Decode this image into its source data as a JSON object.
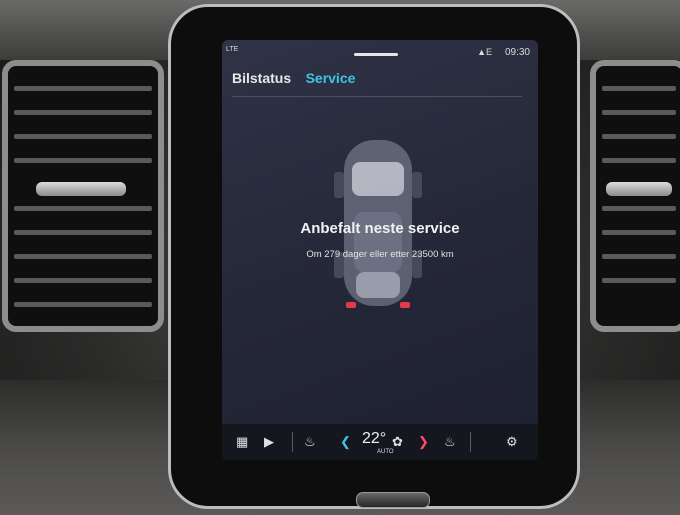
{
  "status_bar": {
    "network": "LTE",
    "time": "09:30"
  },
  "tabs": [
    {
      "label": "Bilstatus",
      "active": false
    },
    {
      "label": "Service",
      "active": true
    }
  ],
  "service": {
    "headline": "Anbefalt neste service",
    "detail": "Om 279 dager eller etter 23500 km"
  },
  "climate_bar": {
    "temperature": "22°",
    "mode": "AUTO"
  },
  "colors": {
    "accent": "#3fc4e8",
    "arrow_right": "#ff4d6d",
    "screen_bg": "#252838"
  }
}
